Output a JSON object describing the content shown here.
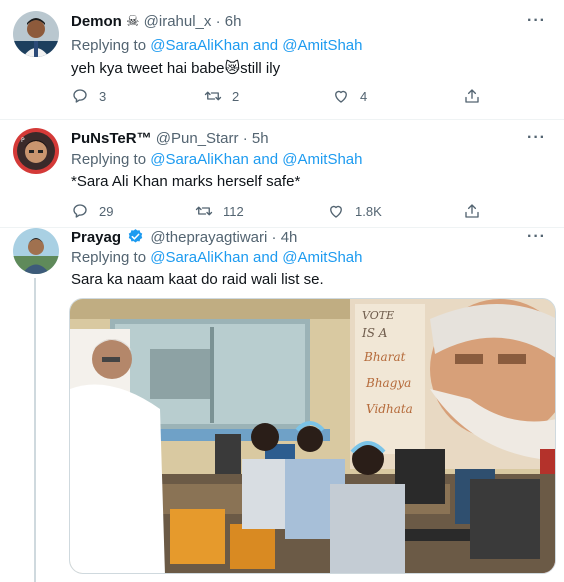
{
  "tweets": [
    {
      "name": "Demon",
      "name_suffix": "☠",
      "handle": "@irahul_x",
      "time": "6h",
      "replying_prefix": "Replying to ",
      "mention1": "@SaraAliKhan",
      "joiner": " and ",
      "mention2": "@AmitShah",
      "text": "yeh kya tweet hai babe",
      "emoji": "😿",
      "text_after": "still ily",
      "replies": "3",
      "retweets": "2",
      "likes": "4"
    },
    {
      "name": "PuNsTeR™",
      "handle": "@Pun_Starr",
      "time": "5h",
      "replying_prefix": "Replying to ",
      "mention1": "@SaraAliKhan",
      "joiner": " and ",
      "mention2": "@AmitShah",
      "text": "*Sara Ali Khan marks herself safe*",
      "replies": "29",
      "retweets": "112",
      "likes": "1.8K"
    },
    {
      "name": "Prayag",
      "handle": "@theprayagtiwari",
      "time": "4h",
      "replying_prefix": "Replying to ",
      "mention1": "@SaraAliKhan",
      "joiner": " and ",
      "mention2": "@AmitShah",
      "text": "Sara ka naam kaat do raid wali list se."
    }
  ],
  "separator": "·",
  "more_label": "···",
  "poster_lines": [
    "VOTE",
    "IS A",
    "Bharat",
    "Bhagya",
    "Vidhata"
  ],
  "colors": {
    "link": "#1d9bf0",
    "muted": "#536471",
    "verified": "#1d9bf0"
  }
}
